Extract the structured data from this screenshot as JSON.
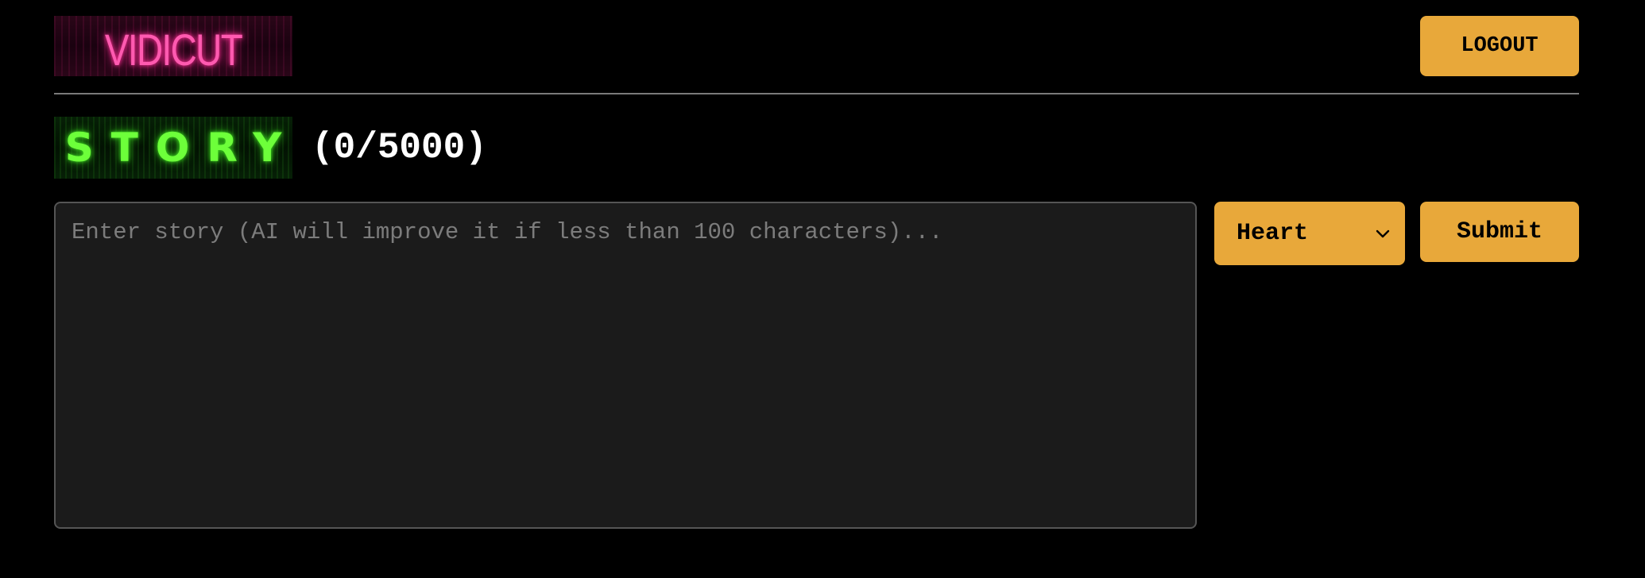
{
  "header": {
    "logo_text": "VIDICUT",
    "logout_label": "LOGOUT"
  },
  "story": {
    "title_logo_text": "STORY",
    "char_count": "(0/5000)",
    "input_value": "",
    "input_placeholder": "Enter story (AI will improve it if less than 100 characters)...",
    "selected_option": "Heart",
    "submit_label": "Submit"
  },
  "colors": {
    "background": "#000000",
    "button": "#e8a83a",
    "logo_pink": "#ff5ab0",
    "story_green": "#6dff3a",
    "textarea_bg": "#1b1b1b"
  },
  "icons": {
    "select_arrow": "chevron-down-icon"
  }
}
